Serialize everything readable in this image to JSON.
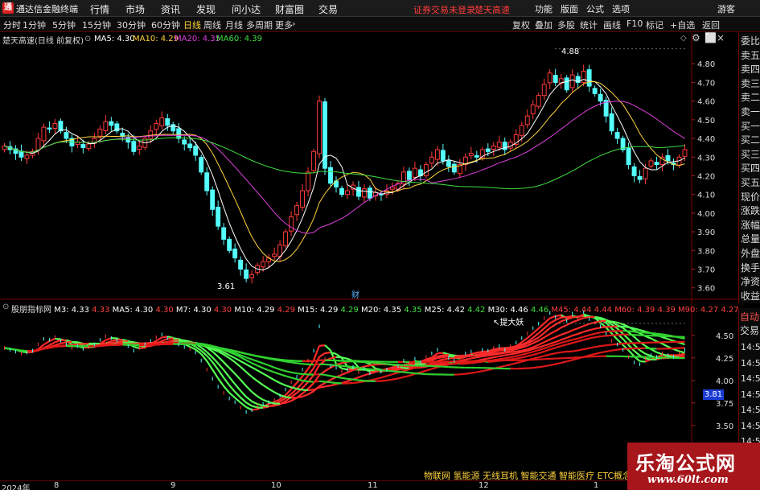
{
  "menubar": {
    "logo": "通",
    "app_title": "通达信金融终端",
    "items": [
      "行情",
      "市场",
      "资讯",
      "发现",
      "问小达",
      "财富圈",
      "交易"
    ],
    "alert1": "证券交易未登录",
    "alert2": "楚天高速",
    "right_items": [
      "功能",
      "版面",
      "公式",
      "选项",
      "画线",
      "游客"
    ]
  },
  "tabbar": {
    "tabs": [
      "分时",
      "1分钟",
      "5分钟",
      "15分钟",
      "30分钟",
      "60分钟",
      "日线",
      "周线",
      "月线",
      "多周期",
      "更多"
    ],
    "active_index": 6,
    "tools": [
      "复权",
      "叠加",
      "多股",
      "统计",
      "画线",
      "F10",
      "标记",
      "+自选",
      "返回"
    ]
  },
  "main_chart": {
    "title": "楚天高速(日线 前复权)",
    "ma_legend": [
      {
        "label": "MA5: 4.30",
        "color": "#ffffff"
      },
      {
        "label": "MA10: 4.29",
        "color": "#ffd23c"
      },
      {
        "label": "MA20: 4.35",
        "color": "#e040e0"
      },
      {
        "label": "MA60: 4.39",
        "color": "#40e040"
      }
    ],
    "high_label": "4.88",
    "low_label": "3.61",
    "cai_marker": "财"
  },
  "chart_data": {
    "type": "candlestick",
    "y_axis_ticks": [
      "4.80",
      "4.70",
      "4.60",
      "4.50",
      "4.40",
      "4.30",
      "4.20",
      "4.10",
      "4.00",
      "3.90",
      "3.80",
      "3.70",
      "3.60"
    ],
    "ylim": [
      3.56,
      4.9
    ],
    "date_ticks": [
      "2024年",
      "8",
      "9",
      "10",
      "11",
      "12",
      "1"
    ],
    "closes": [
      4.36,
      4.34,
      4.32,
      4.3,
      4.31,
      4.33,
      4.4,
      4.46,
      4.45,
      4.48,
      4.44,
      4.4,
      4.36,
      4.38,
      4.35,
      4.37,
      4.4,
      4.45,
      4.49,
      4.47,
      4.44,
      4.41,
      4.38,
      4.33,
      4.36,
      4.4,
      4.44,
      4.48,
      4.51,
      4.47,
      4.44,
      4.4,
      4.37,
      4.35,
      4.31,
      4.22,
      4.12,
      4.02,
      3.93,
      3.86,
      3.8,
      3.76,
      3.7,
      3.65,
      3.67,
      3.72,
      3.74,
      3.76,
      3.78,
      3.83,
      3.9,
      3.98,
      4.04,
      4.12,
      4.22,
      4.33,
      4.6,
      4.24,
      4.16,
      4.14,
      4.1,
      4.12,
      4.15,
      4.09,
      4.13,
      4.08,
      4.11,
      4.1,
      4.12,
      4.14,
      4.16,
      4.22,
      4.18,
      4.24,
      4.2,
      4.26,
      4.3,
      4.34,
      4.28,
      4.25,
      4.22,
      4.26,
      4.3,
      4.32,
      4.3,
      4.34,
      4.33,
      4.36,
      4.38,
      4.34,
      4.38,
      4.42,
      4.47,
      4.52,
      4.58,
      4.63,
      4.69,
      4.75,
      4.7,
      4.72,
      4.66,
      4.74,
      4.7,
      4.76,
      4.68,
      4.64,
      4.6,
      4.52,
      4.44,
      4.4,
      4.34,
      4.26,
      4.2,
      4.18,
      4.24,
      4.28,
      4.26,
      4.3,
      4.28,
      4.26,
      4.3,
      4.34
    ],
    "ma5_last": 4.3,
    "ma10_last": 4.29,
    "ma20_last": 4.35,
    "ma60_last": 4.39
  },
  "sub_chart": {
    "title": "股朋指标网",
    "legend": [
      {
        "label": "M3: 4.33",
        "color": "#ffffff"
      },
      {
        "label": "4.33",
        "color": "#ff4040"
      },
      {
        "label": "MA5: 4.30",
        "color": "#ffffff"
      },
      {
        "label": "4.30",
        "color": "#ff4040"
      },
      {
        "label": "M7: 4.30",
        "color": "#ffffff"
      },
      {
        "label": "4.30",
        "color": "#ff4040"
      },
      {
        "label": "M10: 4.29",
        "color": "#ffffff"
      },
      {
        "label": "4.29",
        "color": "#ff4040"
      },
      {
        "label": "M15: 4.29",
        "color": "#ffffff"
      },
      {
        "label": "4.29",
        "color": "#40e040"
      },
      {
        "label": "M20: 4.35",
        "color": "#ffffff"
      },
      {
        "label": "4.35",
        "color": "#40e040"
      },
      {
        "label": "M25: 4.42",
        "color": "#ffffff"
      },
      {
        "label": "4.42",
        "color": "#40e040"
      },
      {
        "label": "M30: 4.46",
        "color": "#ffffff"
      },
      {
        "label": "4.46",
        "color": "#40e040"
      },
      {
        "label": "M45: 4.44",
        "color": "#ff4040"
      },
      {
        "label": "4.44",
        "color": "#ff4040"
      },
      {
        "label": "M60: 4.39",
        "color": "#ff4040"
      },
      {
        "label": "4.39",
        "color": "#ff4040"
      },
      {
        "label": "M90: 4.27",
        "color": "#ff4040"
      },
      {
        "label": "4.27",
        "color": "#ff4040"
      }
    ],
    "y_ticks": [
      "4.50",
      "4.25",
      "4.00",
      "3.75",
      "3.50"
    ],
    "annotation": "提大妖",
    "price_tag": "3.81"
  },
  "side_panel": {
    "items": [
      "委比",
      "卖五",
      "卖四",
      "卖三",
      "卖二",
      "卖一",
      "买一",
      "买二",
      "买三",
      "买四",
      "买五",
      "现价",
      "涨跌",
      "涨幅",
      "总量",
      "外盘",
      "换手",
      "净资",
      "收益"
    ],
    "sub_head": "自动",
    "sub_head2": "交易",
    "times": [
      "14:5",
      "14:5",
      "14:5",
      "14:5",
      "14:5",
      "14:5",
      "14:5",
      "14:5"
    ]
  },
  "footer": {
    "concepts": "物联网 氢能源 无线耳机 智能交通 智能医疗 ETC概念 揭",
    "watermark_cn": "乐淘公式网",
    "watermark_url": "www.60lt.com"
  },
  "colors": {
    "up": "#ff3a3a",
    "down": "#54ffff",
    "ma5": "#ffffff",
    "ma10": "#ffd23c",
    "ma20": "#e040e0",
    "ma60": "#40e040",
    "brand": "#a6161b"
  }
}
